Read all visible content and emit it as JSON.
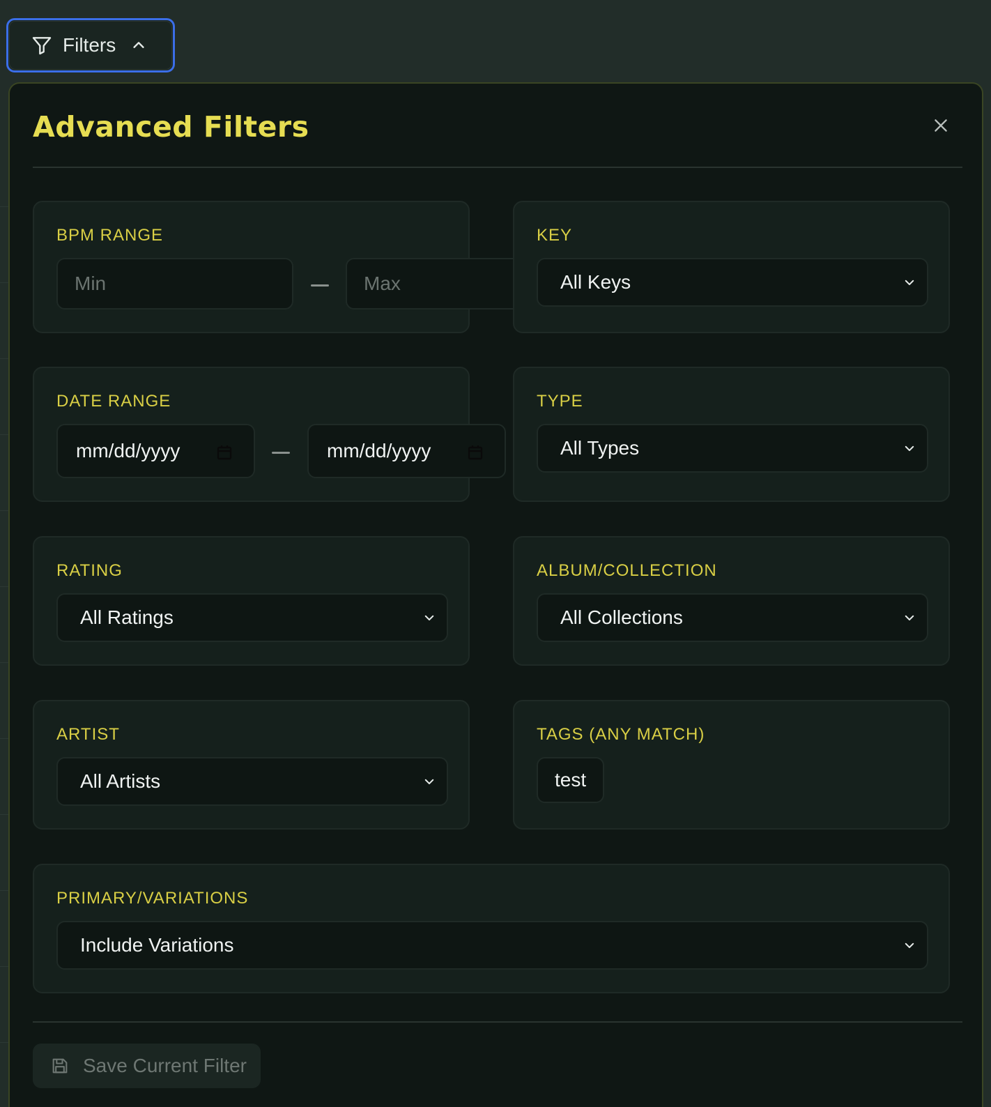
{
  "toggle": {
    "label": "Filters",
    "icon": "filter-icon",
    "chevron": "chevron-up-icon"
  },
  "panel": {
    "title": "Advanced Filters",
    "close_icon": "close-icon",
    "bpm": {
      "label": "BPM RANGE",
      "min_placeholder": "Min",
      "max_placeholder": "Max"
    },
    "key": {
      "label": "KEY",
      "value": "All Keys"
    },
    "date": {
      "label": "DATE RANGE",
      "from_value": "mm/dd/yyyy",
      "to_value": "mm/dd/yyyy"
    },
    "type": {
      "label": "TYPE",
      "value": "All Types"
    },
    "rating": {
      "label": "RATING",
      "value": "All Ratings"
    },
    "album": {
      "label": "ALBUM/COLLECTION",
      "value": "All Collections"
    },
    "artist": {
      "label": "ARTIST",
      "value": "All Artists"
    },
    "tags": {
      "label": "TAGS (ANY MATCH)",
      "items": [
        "test"
      ]
    },
    "variations": {
      "label": "PRIMARY/VARIATIONS",
      "value": "Include Variations"
    },
    "save": {
      "label": "Save Current Filter",
      "icon": "save-icon"
    }
  },
  "colors": {
    "accent_yellow": "#e6dd52",
    "focus_blue": "#3b6ee8",
    "panel_bg": "#0f1714",
    "card_bg": "#15201c"
  }
}
